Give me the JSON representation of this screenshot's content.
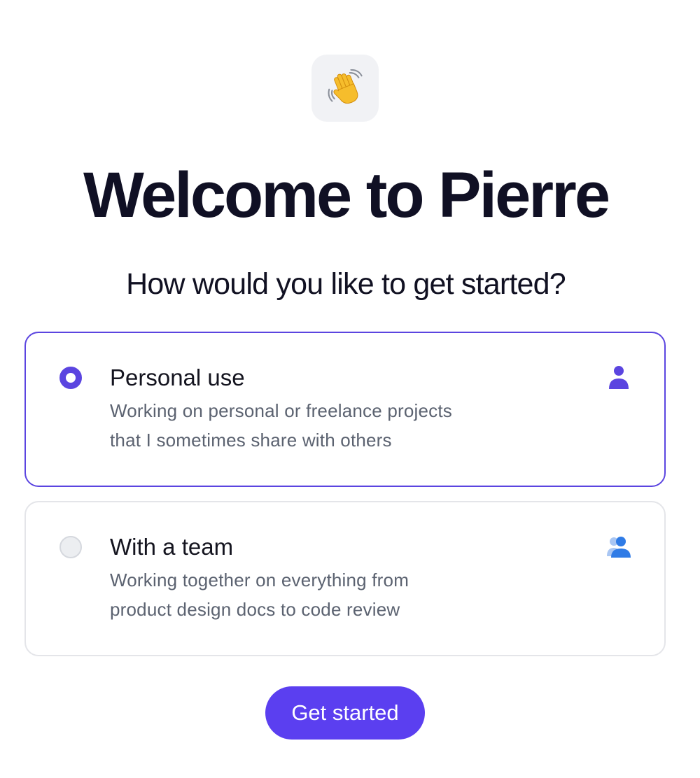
{
  "logo": {
    "icon": "waving-hand-icon",
    "background": "#f1f2f5"
  },
  "header": {
    "title": "Welcome to Pierre",
    "subtitle": "How would you like to get started?"
  },
  "options": [
    {
      "title": "Personal use",
      "description_lines": [
        "Working on personal or freelance projects",
        "that I sometimes share with others"
      ],
      "selected": true,
      "icon": "person-icon",
      "icon_color": "#5b45e0"
    },
    {
      "title": "With a team",
      "description_lines": [
        "Working together on everything from",
        "product design docs to code review"
      ],
      "selected": false,
      "icon": "team-icon",
      "icon_color": "#2f7be6"
    }
  ],
  "cta": {
    "label": "Get started",
    "color": "#5b3ff0"
  },
  "colors": {
    "accent": "#5b45e0",
    "title_text": "#101024",
    "body_text": "#5b6270",
    "border": "#e4e5e9"
  }
}
